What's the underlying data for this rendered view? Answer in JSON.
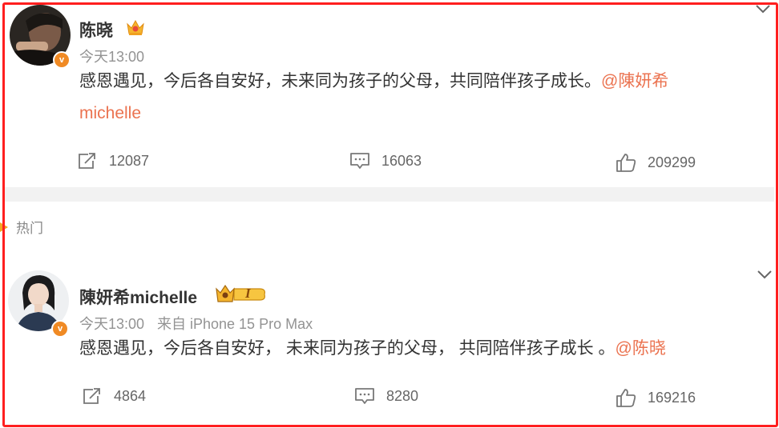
{
  "post1": {
    "author": "陈晓",
    "time": "今天13:00",
    "content_text": "感恩遇见，今后各自安好，未来同为孩子的父母，共同陪伴孩子成长。",
    "mention_line1": "@陳妍希",
    "mention_line2": "michelle",
    "repost_count": "12087",
    "comment_count": "16063",
    "like_count": "209299",
    "avatar_badge": "v"
  },
  "section": {
    "hot_label": "热门"
  },
  "post2": {
    "author": "陳妍希michelle",
    "time": "今天13:00",
    "source": "来自 iPhone 15 Pro Max",
    "content_text": "感恩遇见，今后各自安好， 未来同为孩子的父母， 共同陪伴孩子成长 。",
    "mention": "@陈晓",
    "repost_count": "4864",
    "comment_count": "8280",
    "like_count": "169216",
    "avatar_badge": "v",
    "vip_level": "I"
  },
  "colors": {
    "accent": "#eb7350",
    "frame": "#ff1f1f",
    "badge": "#f08a24"
  }
}
